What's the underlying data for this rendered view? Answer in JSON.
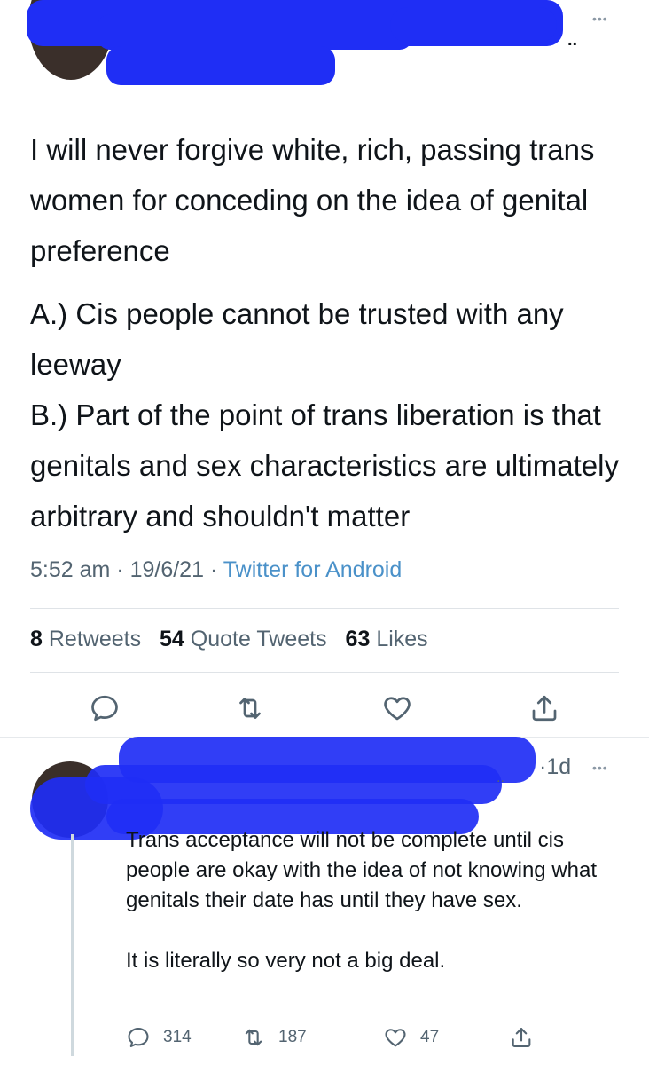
{
  "tweet": {
    "more_label": "•••",
    "paragraphs": [
      "I will never forgive white, rich, passing trans women for conceding on the idea of genital preference",
      "A.) Cis people cannot be trusted with any leeway\nB.) Part of the point of trans liberation is that genitals and sex characteristics are ultimately arbitrary and shouldn't matter"
    ],
    "time": "5:52 am",
    "separator": "·",
    "date": "19/6/21",
    "source": "Twitter for Android",
    "stats": {
      "retweets_count": "8",
      "retweets_label": "Retweets",
      "quotes_count": "54",
      "quotes_label": "Quote Tweets",
      "likes_count": "63",
      "likes_label": "Likes"
    }
  },
  "reply": {
    "time": "·1d",
    "more_label": "•••",
    "paragraphs": [
      "Trans acceptance will not be complete until cis people are okay with the idea of not knowing what genitals their date has until they have sex.",
      "It is literally so very not a big deal."
    ],
    "reply_count": "314",
    "retweet_count": "187",
    "like_count": "47"
  },
  "icons": {
    "reply": "reply-icon",
    "retweet": "retweet-icon",
    "like": "heart-icon",
    "share": "share-icon"
  },
  "colors": {
    "redaction": "#1f2ef5",
    "link": "#4a91c9",
    "muted": "#536471",
    "text": "#0f1419"
  }
}
